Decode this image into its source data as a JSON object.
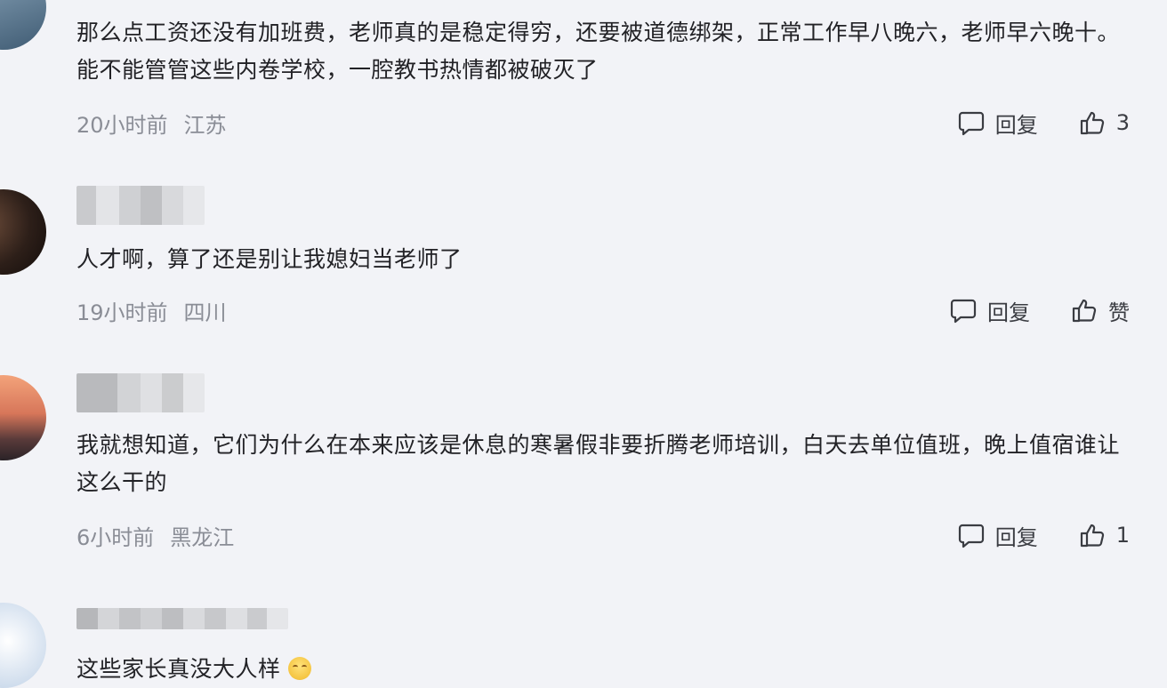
{
  "comments": [
    {
      "text": "那么点工资还没有加班费，老师真的是稳定得穷，还要被道德绑架，正常工作早八晚六，老师早六晚十。能不能管管这些内卷学校，一腔教书热情都被破灭了",
      "time": "20小时前",
      "location": "江苏",
      "reply_label": "回复",
      "like_label": "3"
    },
    {
      "text": "人才啊，算了还是别让我媳妇当老师了",
      "time": "19小时前",
      "location": "四川",
      "reply_label": "回复",
      "like_label": "赞"
    },
    {
      "text": "我就想知道，它们为什么在本来应该是休息的寒暑假非要折腾老师培训，白天去单位值班，晚上值宿谁让这么干的",
      "time": "6小时前",
      "location": "黑龙江",
      "reply_label": "回复",
      "like_label": "1"
    },
    {
      "text": "这些家长真没大人样",
      "emoji": "smirk-emoji"
    }
  ],
  "icons": {
    "reply": "speech-bubble-icon",
    "like": "thumbs-up-icon"
  },
  "colors": {
    "background": "#f2f3f7",
    "meta_text": "#8a8d96",
    "body_text": "#222226"
  }
}
